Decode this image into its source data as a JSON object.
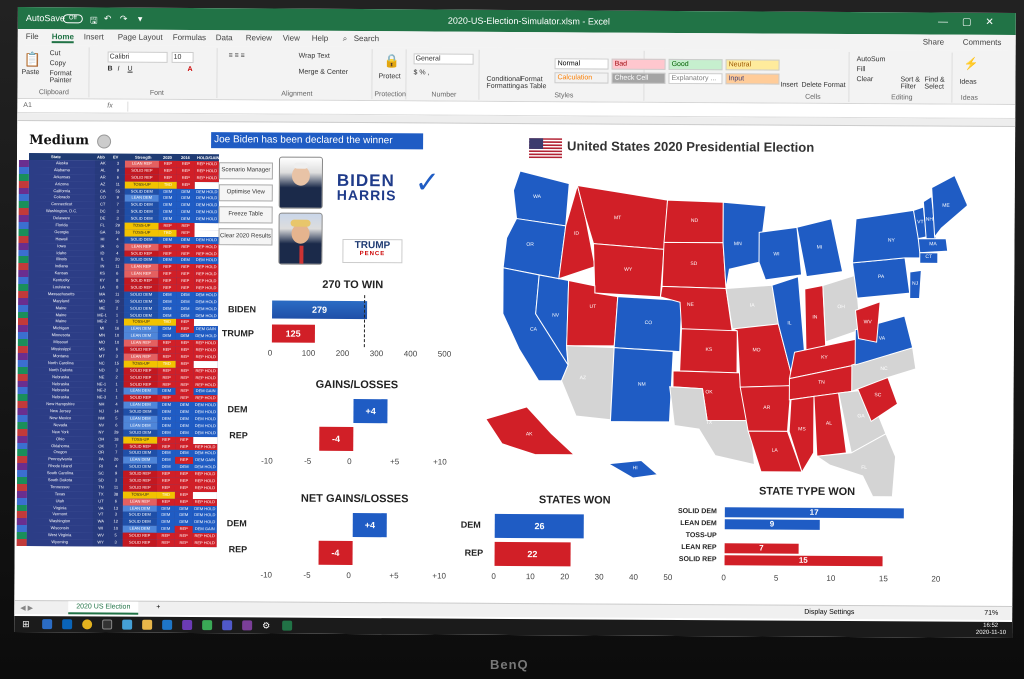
{
  "window": {
    "autosave_label": "AutoSave",
    "autosave_state": "Off",
    "title": "2020-US-Election-Simulator.xlsm - Excel",
    "controls": [
      "—",
      "▢",
      "✕"
    ]
  },
  "menu": {
    "tabs": [
      "File",
      "Home",
      "Insert",
      "Page Layout",
      "Formulas",
      "Data",
      "Review",
      "View",
      "Help"
    ],
    "active_index": 1,
    "search_label": "Search",
    "share_label": "Share",
    "comments_label": "Comments"
  },
  "ribbon": {
    "paste_label": "Paste",
    "cut_label": "Cut",
    "copy_label": "Copy",
    "format_painter_label": "Format Painter",
    "clipboard_label": "Clipboard",
    "font_name": "Calibri",
    "font_size": "10",
    "font_label": "Font",
    "wrap_text_label": "Wrap Text",
    "merge_center_label": "Merge & Center",
    "alignment_label": "Alignment",
    "protect_label": "Protect",
    "protection_label": "Protection",
    "number_format": "General",
    "number_label": "Number",
    "conditional_label": "Conditional Formatting",
    "format_table_label": "Format as Table",
    "styles": [
      {
        "name": "Normal",
        "bg": "#ffffff",
        "fg": "#000000"
      },
      {
        "name": "Bad",
        "bg": "#ffc7ce",
        "fg": "#9c0006"
      },
      {
        "name": "Good",
        "bg": "#c6efce",
        "fg": "#006100"
      },
      {
        "name": "Neutral",
        "bg": "#ffeb9c",
        "fg": "#9c5700"
      },
      {
        "name": "Calculation",
        "bg": "#f2f2f2",
        "fg": "#fa7d00"
      },
      {
        "name": "Check Cell",
        "bg": "#a5a5a5",
        "fg": "#ffffff"
      },
      {
        "name": "Explanatory ...",
        "bg": "#ffffff",
        "fg": "#7f7f7f"
      },
      {
        "name": "Input",
        "bg": "#ffcc99",
        "fg": "#3f3f76"
      }
    ],
    "styles_label": "Styles",
    "insert_label": "Insert",
    "delete_label": "Delete",
    "format_label": "Format",
    "cells_label": "Cells",
    "autosum_label": "AutoSum",
    "fill_label": "Fill",
    "clear_label": "Clear",
    "sort_label": "Sort & Filter",
    "find_label": "Find & Select",
    "editing_label": "Editing",
    "ideas_label": "Ideas",
    "ideas_group_label": "Ideas"
  },
  "formula_bar": {
    "cell_ref": "A1",
    "fx": "fx"
  },
  "sheet": {
    "model_name": "Medium",
    "table_headers": [
      "State",
      "Abb",
      "EV",
      "Strength",
      "2020",
      "2016",
      "HOLD/GAIN"
    ],
    "states": [
      {
        "state": "Alaska",
        "abb": "AK",
        "ev": "3",
        "strength": "LEAN REP",
        "y2020": "REP",
        "y2016": "REP",
        "hold": "REP HOLD"
      },
      {
        "state": "Alabama",
        "abb": "AL",
        "ev": "9",
        "strength": "SOLID REP",
        "y2020": "REP",
        "y2016": "REP",
        "hold": "REP HOLD"
      },
      {
        "state": "Arkansas",
        "abb": "AR",
        "ev": "6",
        "strength": "SOLID REP",
        "y2020": "REP",
        "y2016": "REP",
        "hold": "REP HOLD"
      },
      {
        "state": "Arizona",
        "abb": "AZ",
        "ev": "11",
        "strength": "TOSS-UP",
        "y2020": "TBD",
        "y2016": "REP",
        "hold": ""
      },
      {
        "state": "California",
        "abb": "CA",
        "ev": "55",
        "strength": "SOLID DEM",
        "y2020": "DEM",
        "y2016": "DEM",
        "hold": "DEM HOLD"
      },
      {
        "state": "Colorado",
        "abb": "CO",
        "ev": "9",
        "strength": "LEAN DEM",
        "y2020": "DEM",
        "y2016": "DEM",
        "hold": "DEM HOLD"
      },
      {
        "state": "Connecticut",
        "abb": "CT",
        "ev": "7",
        "strength": "SOLID DEM",
        "y2020": "DEM",
        "y2016": "DEM",
        "hold": "DEM HOLD"
      },
      {
        "state": "Washington, D.C.",
        "abb": "DC",
        "ev": "3",
        "strength": "SOLID DEM",
        "y2020": "DEM",
        "y2016": "DEM",
        "hold": "DEM HOLD"
      },
      {
        "state": "Delaware",
        "abb": "DE",
        "ev": "3",
        "strength": "SOLID DEM",
        "y2020": "DEM",
        "y2016": "DEM",
        "hold": "DEM HOLD"
      },
      {
        "state": "Florida",
        "abb": "FL",
        "ev": "29",
        "strength": "TOSS-UP",
        "y2020": "REP",
        "y2016": "REP",
        "hold": ""
      },
      {
        "state": "Georgia",
        "abb": "GA",
        "ev": "16",
        "strength": "TOSS-UP",
        "y2020": "TBD",
        "y2016": "REP",
        "hold": ""
      },
      {
        "state": "Hawaii",
        "abb": "HI",
        "ev": "4",
        "strength": "SOLID DEM",
        "y2020": "DEM",
        "y2016": "DEM",
        "hold": "DEM HOLD"
      },
      {
        "state": "Iowa",
        "abb": "IA",
        "ev": "6",
        "strength": "LEAN REP",
        "y2020": "REP",
        "y2016": "REP",
        "hold": "REP HOLD"
      },
      {
        "state": "Idaho",
        "abb": "ID",
        "ev": "4",
        "strength": "SOLID REP",
        "y2020": "REP",
        "y2016": "REP",
        "hold": "REP HOLD"
      },
      {
        "state": "Illinois",
        "abb": "IL",
        "ev": "20",
        "strength": "SOLID DEM",
        "y2020": "DEM",
        "y2016": "DEM",
        "hold": "DEM HOLD"
      },
      {
        "state": "Indiana",
        "abb": "IN",
        "ev": "11",
        "strength": "LEAN REP",
        "y2020": "REP",
        "y2016": "REP",
        "hold": "REP HOLD"
      },
      {
        "state": "Kansas",
        "abb": "KS",
        "ev": "6",
        "strength": "LEAN REP",
        "y2020": "REP",
        "y2016": "REP",
        "hold": "REP HOLD"
      },
      {
        "state": "Kentucky",
        "abb": "KY",
        "ev": "8",
        "strength": "SOLID REP",
        "y2020": "REP",
        "y2016": "REP",
        "hold": "REP HOLD"
      },
      {
        "state": "Louisiana",
        "abb": "LA",
        "ev": "8",
        "strength": "SOLID REP",
        "y2020": "REP",
        "y2016": "REP",
        "hold": "REP HOLD"
      },
      {
        "state": "Massachusetts",
        "abb": "MA",
        "ev": "11",
        "strength": "SOLID DEM",
        "y2020": "DEM",
        "y2016": "DEM",
        "hold": "DEM HOLD"
      },
      {
        "state": "Maryland",
        "abb": "MD",
        "ev": "10",
        "strength": "SOLID DEM",
        "y2020": "DEM",
        "y2016": "DEM",
        "hold": "DEM HOLD"
      },
      {
        "state": "Maine",
        "abb": "ME",
        "ev": "2",
        "strength": "SOLID DEM",
        "y2020": "DEM",
        "y2016": "DEM",
        "hold": "DEM HOLD"
      },
      {
        "state": "Maine",
        "abb": "ME-1",
        "ev": "1",
        "strength": "SOLID DEM",
        "y2020": "DEM",
        "y2016": "DEM",
        "hold": "DEM HOLD"
      },
      {
        "state": "Maine",
        "abb": "ME-2",
        "ev": "1",
        "strength": "TOSS-UP",
        "y2020": "TBD",
        "y2016": "REP",
        "hold": ""
      },
      {
        "state": "Michigan",
        "abb": "MI",
        "ev": "16",
        "strength": "LEAN DEM",
        "y2020": "DEM",
        "y2016": "REP",
        "hold": "DEM GAIN"
      },
      {
        "state": "Minnesota",
        "abb": "MN",
        "ev": "10",
        "strength": "LEAN DEM",
        "y2020": "DEM",
        "y2016": "DEM",
        "hold": "DEM HOLD"
      },
      {
        "state": "Missouri",
        "abb": "MO",
        "ev": "10",
        "strength": "LEAN REP",
        "y2020": "REP",
        "y2016": "REP",
        "hold": "REP HOLD"
      },
      {
        "state": "Mississippi",
        "abb": "MS",
        "ev": "6",
        "strength": "SOLID REP",
        "y2020": "REP",
        "y2016": "REP",
        "hold": "REP HOLD"
      },
      {
        "state": "Montana",
        "abb": "MT",
        "ev": "3",
        "strength": "LEAN REP",
        "y2020": "REP",
        "y2016": "REP",
        "hold": "REP HOLD"
      },
      {
        "state": "North Carolina",
        "abb": "NC",
        "ev": "15",
        "strength": "TOSS-UP",
        "y2020": "TBD",
        "y2016": "REP",
        "hold": ""
      },
      {
        "state": "North Dakota",
        "abb": "ND",
        "ev": "3",
        "strength": "SOLID REP",
        "y2020": "REP",
        "y2016": "REP",
        "hold": "REP HOLD"
      },
      {
        "state": "Nebraska",
        "abb": "NE",
        "ev": "2",
        "strength": "SOLID REP",
        "y2020": "REP",
        "y2016": "REP",
        "hold": "REP HOLD"
      },
      {
        "state": "Nebraska",
        "abb": "NE-1",
        "ev": "1",
        "strength": "SOLID REP",
        "y2020": "REP",
        "y2016": "REP",
        "hold": "REP HOLD"
      },
      {
        "state": "Nebraska",
        "abb": "NE-2",
        "ev": "1",
        "strength": "LEAN DEM",
        "y2020": "DEM",
        "y2016": "REP",
        "hold": "DEM GAIN"
      },
      {
        "state": "Nebraska",
        "abb": "NE-3",
        "ev": "1",
        "strength": "SOLID REP",
        "y2020": "REP",
        "y2016": "REP",
        "hold": "REP HOLD"
      },
      {
        "state": "New Hampshire",
        "abb": "NH",
        "ev": "4",
        "strength": "LEAN DEM",
        "y2020": "DEM",
        "y2016": "DEM",
        "hold": "DEM HOLD"
      },
      {
        "state": "New Jersey",
        "abb": "NJ",
        "ev": "14",
        "strength": "SOLID DEM",
        "y2020": "DEM",
        "y2016": "DEM",
        "hold": "DEM HOLD"
      },
      {
        "state": "New Mexico",
        "abb": "NM",
        "ev": "5",
        "strength": "LEAN DEM",
        "y2020": "DEM",
        "y2016": "DEM",
        "hold": "DEM HOLD"
      },
      {
        "state": "Nevada",
        "abb": "NV",
        "ev": "6",
        "strength": "LEAN DEM",
        "y2020": "DEM",
        "y2016": "DEM",
        "hold": "DEM HOLD"
      },
      {
        "state": "New York",
        "abb": "NY",
        "ev": "29",
        "strength": "SOLID DEM",
        "y2020": "DEM",
        "y2016": "DEM",
        "hold": "DEM HOLD"
      },
      {
        "state": "Ohio",
        "abb": "OH",
        "ev": "18",
        "strength": "TOSS-UP",
        "y2020": "REP",
        "y2016": "REP",
        "hold": ""
      },
      {
        "state": "Oklahoma",
        "abb": "OK",
        "ev": "7",
        "strength": "SOLID REP",
        "y2020": "REP",
        "y2016": "REP",
        "hold": "REP HOLD"
      },
      {
        "state": "Oregon",
        "abb": "OR",
        "ev": "7",
        "strength": "SOLID DEM",
        "y2020": "DEM",
        "y2016": "DEM",
        "hold": "DEM HOLD"
      },
      {
        "state": "Pennsylvania",
        "abb": "PA",
        "ev": "20",
        "strength": "LEAN DEM",
        "y2020": "DEM",
        "y2016": "REP",
        "hold": "DEM GAIN"
      },
      {
        "state": "Rhode Island",
        "abb": "RI",
        "ev": "4",
        "strength": "SOLID DEM",
        "y2020": "DEM",
        "y2016": "DEM",
        "hold": "DEM HOLD"
      },
      {
        "state": "South Carolina",
        "abb": "SC",
        "ev": "9",
        "strength": "SOLID REP",
        "y2020": "REP",
        "y2016": "REP",
        "hold": "REP HOLD"
      },
      {
        "state": "South Dakota",
        "abb": "SD",
        "ev": "3",
        "strength": "SOLID REP",
        "y2020": "REP",
        "y2016": "REP",
        "hold": "REP HOLD"
      },
      {
        "state": "Tennessee",
        "abb": "TN",
        "ev": "11",
        "strength": "SOLID REP",
        "y2020": "REP",
        "y2016": "REP",
        "hold": "REP HOLD"
      },
      {
        "state": "Texas",
        "abb": "TX",
        "ev": "38",
        "strength": "TOSS-UP",
        "y2020": "TBD",
        "y2016": "REP",
        "hold": ""
      },
      {
        "state": "Utah",
        "abb": "UT",
        "ev": "6",
        "strength": "LEAN REP",
        "y2020": "REP",
        "y2016": "REP",
        "hold": "REP HOLD"
      },
      {
        "state": "Virginia",
        "abb": "VA",
        "ev": "13",
        "strength": "LEAN DEM",
        "y2020": "DEM",
        "y2016": "DEM",
        "hold": "DEM HOLD"
      },
      {
        "state": "Vermont",
        "abb": "VT",
        "ev": "3",
        "strength": "SOLID DEM",
        "y2020": "DEM",
        "y2016": "DEM",
        "hold": "DEM HOLD"
      },
      {
        "state": "Washington",
        "abb": "WA",
        "ev": "12",
        "strength": "SOLID DEM",
        "y2020": "DEM",
        "y2016": "DEM",
        "hold": "DEM HOLD"
      },
      {
        "state": "Wisconsin",
        "abb": "WI",
        "ev": "10",
        "strength": "LEAN DEM",
        "y2020": "DEM",
        "y2016": "REP",
        "hold": "DEM GAIN"
      },
      {
        "state": "West Virginia",
        "abb": "WV",
        "ev": "5",
        "strength": "SOLID REP",
        "y2020": "REP",
        "y2016": "REP",
        "hold": "REP HOLD"
      },
      {
        "state": "Wyoming",
        "abb": "WY",
        "ev": "3",
        "strength": "SOLID REP",
        "y2020": "REP",
        "y2016": "REP",
        "hold": "REP HOLD"
      }
    ],
    "winner_banner": "Joe Biden has been declared the winner",
    "buttons": [
      "Scenario Manager",
      "Optimise View",
      "Freeze Table",
      "Clear 2020 Results"
    ],
    "biden_logo": {
      "line1": "BIDEN",
      "line2": "HARRIS"
    },
    "trump_logo": {
      "line1": "TRUMP",
      "line2": "PENCE"
    },
    "map_title": "United States 2020 Presidential Election",
    "colors": {
      "dem": "#1f5cc4",
      "rep": "#d11f27",
      "tossup": "#d9d9d9",
      "tossup_strength": "#f2c200",
      "header": "#1f3b73"
    }
  },
  "chart_data": [
    {
      "type": "bar",
      "title": "270 TO WIN",
      "categories": [
        "BIDEN",
        "TRUMP"
      ],
      "values": [
        279,
        125
      ],
      "ticks": [
        "0",
        "100",
        "200",
        "300",
        "400",
        "500"
      ],
      "xlim": [
        0,
        500
      ],
      "threshold": 270
    },
    {
      "type": "bar",
      "title": "GAINS/LOSSES",
      "categories": [
        "DEM",
        "REP"
      ],
      "values": [
        4,
        -4
      ],
      "labels": [
        "+4",
        "-4"
      ],
      "ticks": [
        "-10",
        "-5",
        "0",
        "+5",
        "+10"
      ],
      "xlim": [
        -10,
        10
      ]
    },
    {
      "type": "bar",
      "title": "NET GAINS/LOSSES",
      "categories": [
        "DEM",
        "REP"
      ],
      "values": [
        4,
        -4
      ],
      "labels": [
        "+4",
        "-4"
      ],
      "ticks": [
        "-10",
        "-5",
        "0",
        "+5",
        "+10"
      ],
      "xlim": [
        -10,
        10
      ]
    },
    {
      "type": "bar",
      "title": "STATES WON",
      "categories": [
        "DEM",
        "REP"
      ],
      "values": [
        26,
        22
      ],
      "ticks": [
        "0",
        "10",
        "20",
        "30",
        "40",
        "50"
      ],
      "xlim": [
        0,
        50
      ]
    },
    {
      "type": "bar",
      "title": "STATE TYPE WON",
      "categories": [
        "SOLID DEM",
        "LEAN DEM",
        "TOSS-UP",
        "LEAN REP",
        "SOLID REP"
      ],
      "values": [
        17,
        9,
        0,
        7,
        15
      ],
      "value_labels": [
        "17",
        "9",
        "",
        "7",
        "15"
      ],
      "ticks": [
        "0",
        "5",
        "10",
        "15",
        "20"
      ],
      "xlim": [
        0,
        20
      ]
    }
  ],
  "map": {
    "states": [
      {
        "abb": "WA",
        "party": "dem"
      },
      {
        "abb": "OR",
        "party": "dem"
      },
      {
        "abb": "CA",
        "party": "dem"
      },
      {
        "abb": "NV",
        "party": "dem"
      },
      {
        "abb": "ID",
        "party": "rep"
      },
      {
        "abb": "MT",
        "party": "rep"
      },
      {
        "abb": "WY",
        "party": "rep"
      },
      {
        "abb": "UT",
        "party": "rep"
      },
      {
        "abb": "CO",
        "party": "dem"
      },
      {
        "abb": "AZ",
        "party": "tossup"
      },
      {
        "abb": "NM",
        "party": "dem"
      },
      {
        "abb": "ND",
        "party": "rep"
      },
      {
        "abb": "SD",
        "party": "rep"
      },
      {
        "abb": "NE",
        "party": "rep"
      },
      {
        "abb": "KS",
        "party": "rep"
      },
      {
        "abb": "OK",
        "party": "rep"
      },
      {
        "abb": "TX",
        "party": "tossup"
      },
      {
        "abb": "MN",
        "party": "dem"
      },
      {
        "abb": "IA",
        "party": "tossup"
      },
      {
        "abb": "MO",
        "party": "rep"
      },
      {
        "abb": "AR",
        "party": "rep"
      },
      {
        "abb": "LA",
        "party": "rep"
      },
      {
        "abb": "WI",
        "party": "dem"
      },
      {
        "abb": "IL",
        "party": "dem"
      },
      {
        "abb": "MI",
        "party": "dem"
      },
      {
        "abb": "IN",
        "party": "rep"
      },
      {
        "abb": "OH",
        "party": "tossup"
      },
      {
        "abb": "KY",
        "party": "rep"
      },
      {
        "abb": "TN",
        "party": "rep"
      },
      {
        "abb": "MS",
        "party": "rep"
      },
      {
        "abb": "AL",
        "party": "rep"
      },
      {
        "abb": "GA",
        "party": "tossup"
      },
      {
        "abb": "FL",
        "party": "tossup"
      },
      {
        "abb": "SC",
        "party": "rep"
      },
      {
        "abb": "NC",
        "party": "tossup"
      },
      {
        "abb": "VA",
        "party": "dem"
      },
      {
        "abb": "WV",
        "party": "rep"
      },
      {
        "abb": "PA",
        "party": "dem"
      },
      {
        "abb": "NY",
        "party": "dem"
      },
      {
        "abb": "VT",
        "party": "dem"
      },
      {
        "abb": "NH",
        "party": "dem"
      },
      {
        "abb": "ME",
        "party": "dem"
      },
      {
        "abb": "MA",
        "party": "dem"
      },
      {
        "abb": "CT",
        "party": "dem"
      },
      {
        "abb": "NJ",
        "party": "dem"
      },
      {
        "abb": "AK",
        "party": "rep"
      },
      {
        "abb": "HI",
        "party": "dem"
      }
    ]
  },
  "tabs": {
    "sheet_name": "2020 US Election",
    "add": "+"
  },
  "status": {
    "display_settings": "Display Settings",
    "zoom": "71%"
  },
  "taskbar": {
    "time": "16:52",
    "date": "2020-11-10"
  },
  "monitor_brand": "BenQ"
}
